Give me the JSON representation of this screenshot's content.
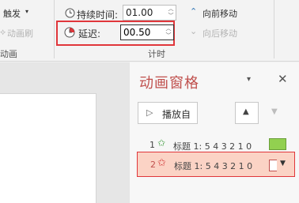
{
  "ribbon": {
    "trigger_label": "触发",
    "animation_painter_label": "动画刷",
    "duration_label": "持续时间:",
    "duration_value": "01.00",
    "delay_label": "延迟:",
    "delay_value": "00.50",
    "move_earlier_label": "向前移动",
    "move_later_label": "向后移动",
    "group_animation_label": "动画",
    "group_timing_label": "计时"
  },
  "pane": {
    "title": "动画窗格",
    "play_label": "播放自",
    "items": [
      {
        "index": "1",
        "label": "标题 1: 5 4 3 2 1 0"
      },
      {
        "index": "2",
        "label": "标题 1: 5 4 3 2 1 0"
      }
    ]
  },
  "colors": {
    "accent": "#c0504d",
    "highlight_border": "#e0363b",
    "selected_row": "#fbd3c5",
    "bar_green": "#92d050"
  }
}
